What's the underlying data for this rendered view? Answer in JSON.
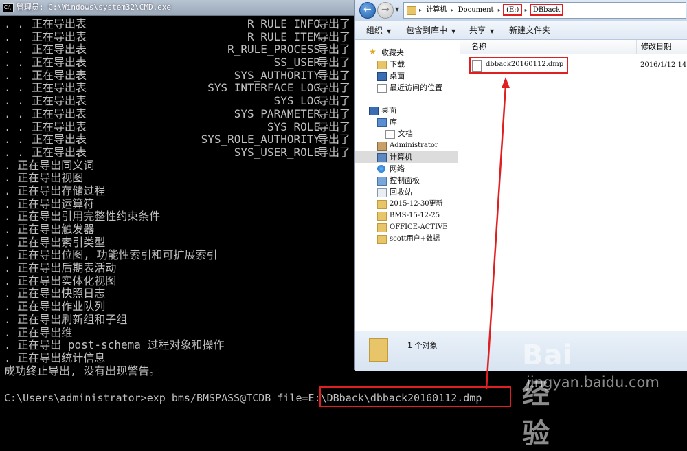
{
  "cmd": {
    "title": "管理员: C:\\Windows\\system32\\CMD.exe",
    "table_rows": [
      {
        "dots": ". .",
        "label": "正在导出表",
        "table": "R_RULE_INFO",
        "status": "导出了"
      },
      {
        "dots": ". .",
        "label": "正在导出表",
        "table": "R_RULE_ITEM",
        "status": "导出了"
      },
      {
        "dots": ". .",
        "label": "正在导出表",
        "table": "R_RULE_PROCESS",
        "status": "导出了"
      },
      {
        "dots": ". .",
        "label": "正在导出表",
        "table": "SS_USER",
        "status": "导出了"
      },
      {
        "dots": ". .",
        "label": "正在导出表",
        "table": "SYS_AUTHORITY",
        "status": "导出了"
      },
      {
        "dots": ". .",
        "label": "正在导出表",
        "table": "SYS_INTERFACE_LOG",
        "status": "导出了"
      },
      {
        "dots": ". .",
        "label": "正在导出表",
        "table": "SYS_LOG",
        "status": "导出了"
      },
      {
        "dots": ". .",
        "label": "正在导出表",
        "table": "SYS_PARAMETER",
        "status": "导出了"
      },
      {
        "dots": ". .",
        "label": "正在导出表",
        "table": "SYS_ROLE",
        "status": "导出了"
      },
      {
        "dots": ". .",
        "label": "正在导出表",
        "table": "SYS_ROLE_AUTHORITY",
        "status": "导出了"
      },
      {
        "dots": ". .",
        "label": "正在导出表",
        "table": "SYS_USER_ROLE",
        "status": "导出了"
      }
    ],
    "lines": [
      ". 正在导出同义词",
      ". 正在导出视图",
      ". 正在导出存储过程",
      ". 正在导出运算符",
      ". 正在导出引用完整性约束条件",
      ". 正在导出触发器",
      ". 正在导出索引类型",
      ". 正在导出位图, 功能性索引和可扩展索引",
      ". 正在导出后期表活动",
      ". 正在导出实体化视图",
      ". 正在导出快照日志",
      ". 正在导出作业队列",
      ". 正在导出刷新组和子组",
      ". 正在导出维",
      ". 正在导出 post-schema 过程对象和操作",
      ". 正在导出统计信息",
      "成功终止导出, 没有出现警告。"
    ],
    "command_line": "C:\\Users\\administrator>exp bms/BMSPASS@TCDB file=E:\\DBback\\dbback20160112.dmp"
  },
  "explorer": {
    "address": {
      "crumbs": [
        "计算机",
        "Document",
        "(E:)",
        "DBback"
      ]
    },
    "toolbar": {
      "organize": "组织",
      "include_in_library": "包含到库中",
      "share": "共享",
      "new_folder": "新建文件夹"
    },
    "nav": {
      "favorites": "收藏夹",
      "downloads": "下载",
      "desktop_fav": "桌面",
      "recent": "最近访问的位置",
      "desktop": "桌面",
      "libraries": "库",
      "documents": "文档",
      "administrator": "Administrator",
      "computer": "计算机",
      "network": "网络",
      "control_panel": "控制面板",
      "recycle_bin": "回收站",
      "folder1": "2015-12-30更新",
      "folder2": "BMS-15-12-25",
      "folder3": "OFFICE-ACTIVE",
      "folder4": "scott用户+数据"
    },
    "columns": {
      "name": "名称",
      "modified": "修改日期"
    },
    "files": [
      {
        "name": "dbback20160112.dmp",
        "modified": "2016/1/12 14"
      }
    ],
    "details": {
      "count_text": "1 个对象"
    }
  },
  "watermark": {
    "logo": "Bai 经验",
    "url": "jingyan.baidu.com"
  },
  "colors": {
    "highlight": "#e02020",
    "console_bg": "#000000",
    "console_text": "#c0c0c0"
  }
}
